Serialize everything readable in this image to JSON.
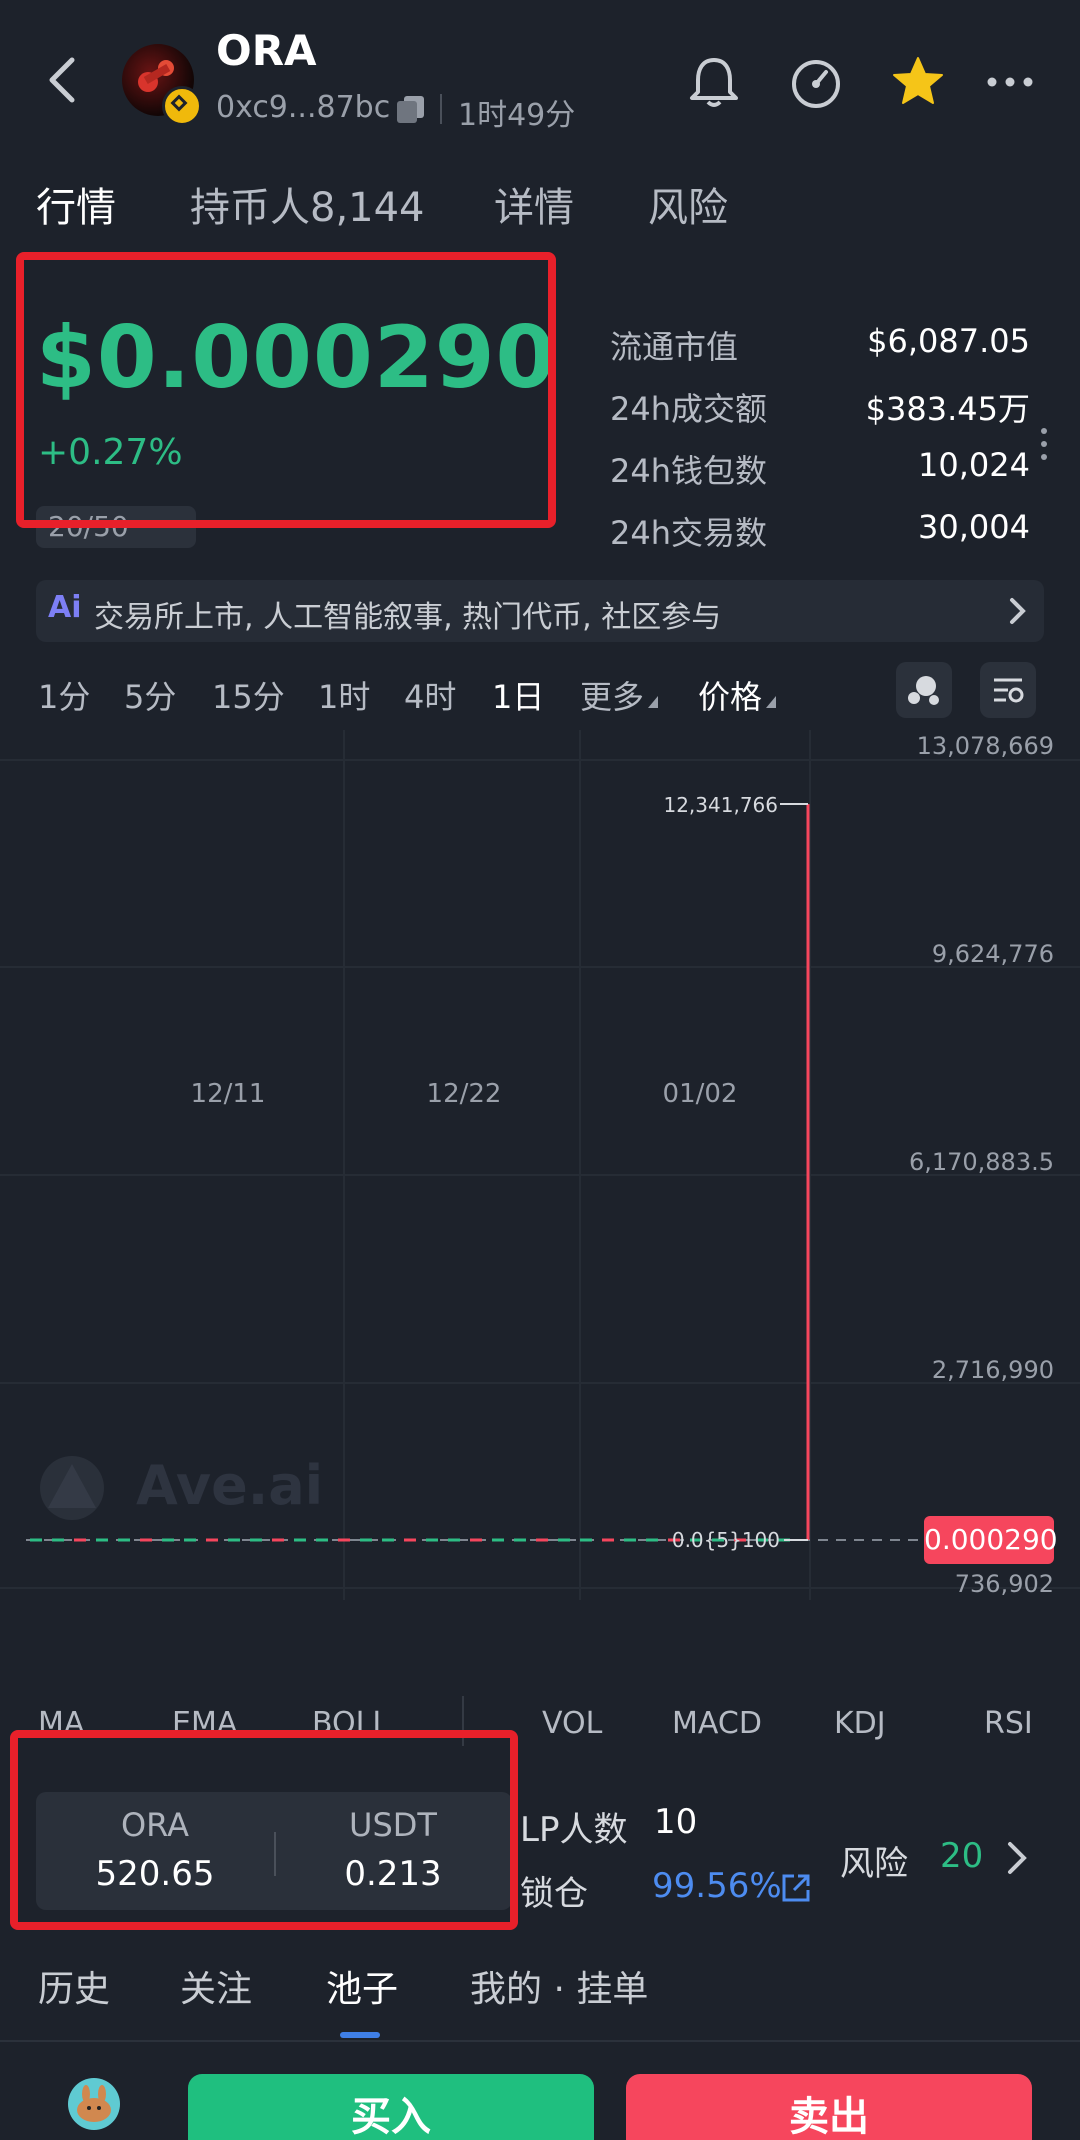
{
  "header": {
    "token_name": "ORA",
    "address": "0xc9...87bc",
    "age": "1时49分"
  },
  "tabs": [
    {
      "label": "行情"
    },
    {
      "label": "持币人8,144"
    },
    {
      "label": "详情"
    },
    {
      "label": "风险"
    }
  ],
  "price": {
    "value": "$0.000290",
    "change": "+0.27%",
    "badge": "20/50"
  },
  "stats": [
    {
      "label": "流通市值",
      "value": "$6,087.05"
    },
    {
      "label": "24h成交额",
      "value": "$383.45万"
    },
    {
      "label": "24h钱包数",
      "value": "10,024"
    },
    {
      "label": "24h交易数",
      "value": "30,004"
    }
  ],
  "tags": {
    "logo": "Ai",
    "text": "交易所上市, 人工智能叙事, 热门代币, 社区参与"
  },
  "timeframes": [
    {
      "label": "1分"
    },
    {
      "label": "5分"
    },
    {
      "label": "15分"
    },
    {
      "label": "1时"
    },
    {
      "label": "4时"
    },
    {
      "label": "1日"
    },
    {
      "label": "更多"
    },
    {
      "label": "价格"
    }
  ],
  "chart_data": {
    "type": "bar",
    "y_axis_labels": [
      "13,078,669",
      "9,624,776",
      "6,170,883.5",
      "2,716,990",
      "736,902"
    ],
    "x_labels": [
      "12/11",
      "12/22",
      "01/02"
    ],
    "peak_label": "12,341,766",
    "low_label": "0.0{5}100",
    "current_price_label": "0.000290",
    "watermark": "Ave.ai",
    "spike_value": 12341766,
    "ylim": [
      -736902,
      13078669
    ]
  },
  "indicators": [
    "MA",
    "EMA",
    "BOLL",
    "VOL",
    "MACD",
    "KDJ",
    "RSI"
  ],
  "pool": {
    "base_symbol": "ORA",
    "base_value": "520.65",
    "quote_symbol": "USDT",
    "quote_value": "0.213"
  },
  "lp": {
    "label": "LP人数",
    "value": "10",
    "lock_label": "锁仓",
    "lock_value": "99.56%"
  },
  "risk": {
    "label": "风险",
    "value": "20"
  },
  "bottom_tabs": [
    {
      "label": "历史"
    },
    {
      "label": "关注"
    },
    {
      "label": "池子"
    },
    {
      "label": "我的 · 挂单"
    }
  ],
  "actions": {
    "buy": "买入",
    "sell": "卖出"
  },
  "colors": {
    "up": "#2dbd85",
    "down": "#f6465d",
    "accent": "#3f7fe6",
    "background": "#1d222b"
  }
}
